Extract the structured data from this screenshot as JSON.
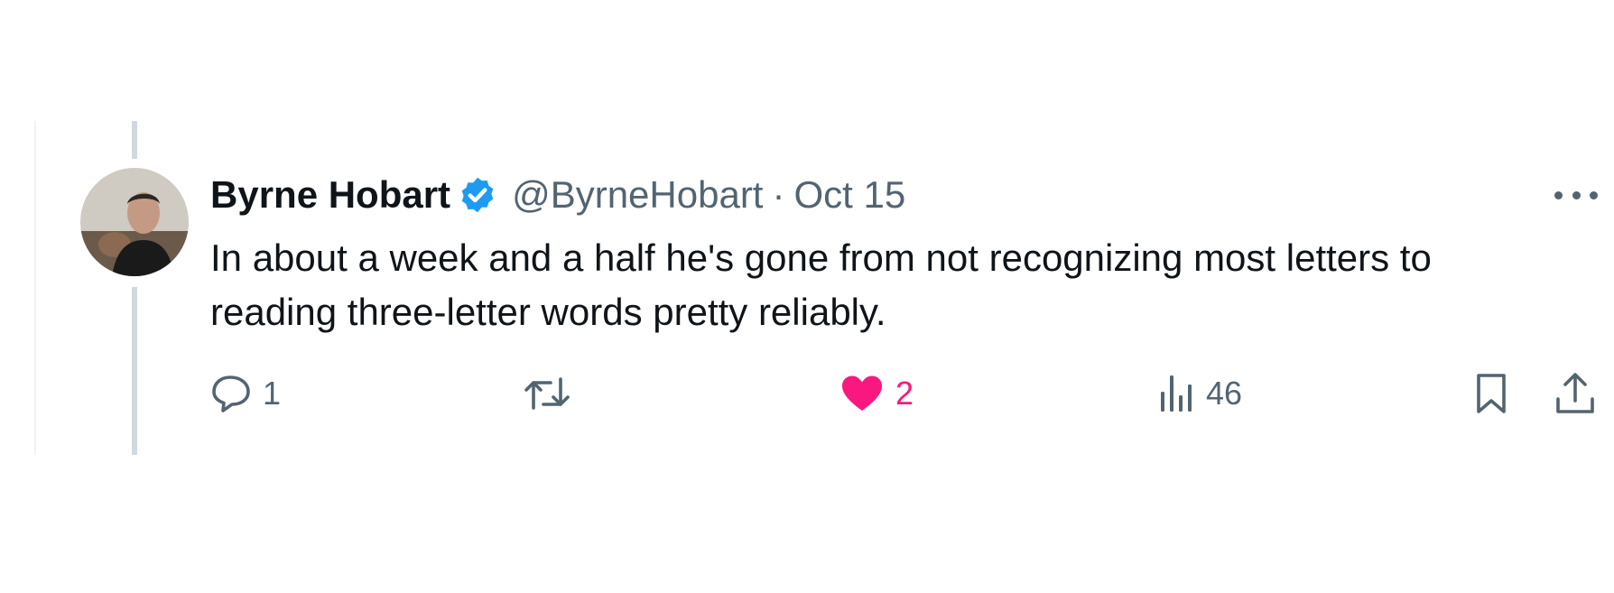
{
  "tweet": {
    "author": {
      "display_name": "Byrne Hobart",
      "handle": "@ByrneHobart",
      "verified_icon": "verified-badge-icon",
      "avatar": "profile-photo"
    },
    "separator": "·",
    "date": "Oct 15",
    "more_icon": "more-horizontal-icon",
    "text": "In about a week and a half he's gone from not recognizing most letters to reading three-letter words pretty reliably.",
    "actions": {
      "reply": {
        "icon": "reply-icon",
        "count": "1"
      },
      "retweet": {
        "icon": "retweet-icon",
        "count": ""
      },
      "like": {
        "icon": "heart-filled-icon",
        "count": "2",
        "color": "#f91880"
      },
      "views": {
        "icon": "views-chart-icon",
        "count": "46"
      },
      "bookmark": {
        "icon": "bookmark-icon"
      },
      "share": {
        "icon": "share-icon"
      }
    }
  },
  "colors": {
    "text_primary": "#0f1419",
    "text_secondary": "#536471",
    "verified_blue": "#1d9bf0",
    "like_pink": "#f91880",
    "thread_line": "#cfd9de"
  }
}
